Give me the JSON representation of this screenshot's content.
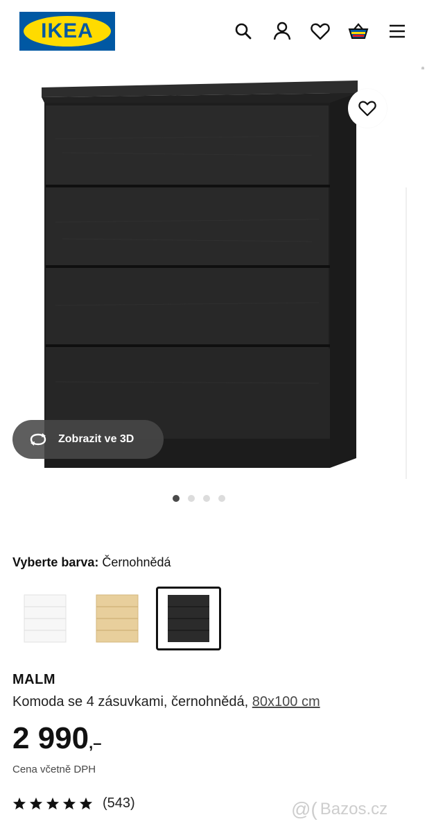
{
  "header": {
    "logo_text": "IKEA",
    "icons": [
      "search-icon",
      "user-icon",
      "heart-icon",
      "basket-icon",
      "menu-icon"
    ]
  },
  "media": {
    "view_3d_label": "Zobrazit ve 3D",
    "carousel_count": 4,
    "carousel_active": 1
  },
  "color_select": {
    "label": "Vyberte barva:",
    "value": "Černohnědá",
    "options": [
      "white",
      "oak",
      "black-brown"
    ],
    "selected": "black-brown"
  },
  "product": {
    "name": "MALM",
    "description": "Komoda se 4 zásuvkami, černohnědá, ",
    "size_link": "80x100 cm",
    "price": "2 990",
    "price_suffix": ",–",
    "vat_note": "Cena včetně DPH",
    "rating_stars": 5,
    "review_count": "(543)"
  },
  "watermark": {
    "symbol": "@(",
    "text": "Bazos.cz"
  },
  "colors": {
    "ikea_blue": "#0058a3",
    "ikea_yellow": "#ffdb00",
    "dresser": "#262626",
    "pill_bg": "#484848"
  }
}
